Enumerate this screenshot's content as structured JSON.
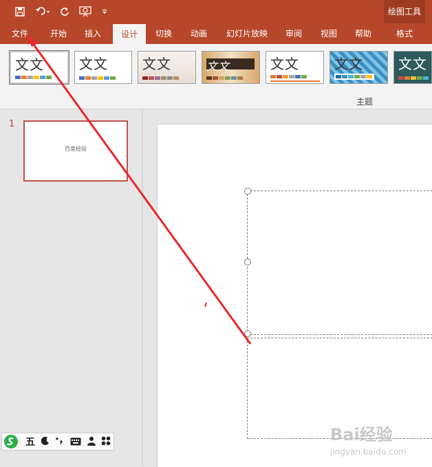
{
  "colors": {
    "accent": "#b7472a",
    "context_tab": "#9e3c22",
    "arrow": "#e8282d"
  },
  "context_tab_group": "绘图工具",
  "tabs": [
    {
      "label": "文件"
    },
    {
      "label": "开始"
    },
    {
      "label": "插入"
    },
    {
      "label": "设计",
      "active": true
    },
    {
      "label": "切换"
    },
    {
      "label": "动画"
    },
    {
      "label": "幻灯片放映"
    },
    {
      "label": "审阅"
    },
    {
      "label": "视图"
    },
    {
      "label": "帮助"
    },
    {
      "label": "格式"
    }
  ],
  "themes": [
    {
      "sample": "文文",
      "selected": true
    },
    {
      "sample": "文文"
    },
    {
      "sample": "文文"
    },
    {
      "sample": "文文"
    },
    {
      "sample": "文文"
    },
    {
      "sample": "文文"
    },
    {
      "sample": "文文"
    }
  ],
  "theme_group_label": "主题",
  "slides": [
    {
      "number": "1",
      "title": "百度经验"
    }
  ],
  "ime": {
    "mode": "五",
    "icons": [
      "sogou-icon",
      "moon-icon",
      "punctuation-icon",
      "keyboard-icon",
      "user-icon",
      "grid-icon"
    ]
  },
  "watermark": {
    "text": "Bai经验",
    "url": "jingyan.baidu.com"
  }
}
